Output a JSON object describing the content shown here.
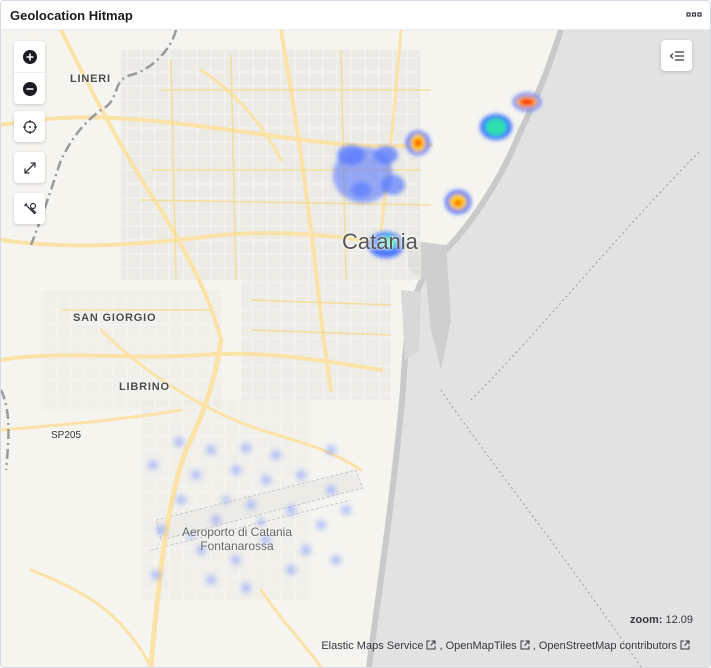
{
  "panel": {
    "title": "Geolocation Hitmap"
  },
  "map": {
    "labels": {
      "lineri": "LINERI",
      "san_giorgio": "SAN GIORGIO",
      "librino": "LIBRINO",
      "sp205": "SP205",
      "city": "Catania",
      "airport_line1": "Aeroporto di Catania",
      "airport_line2": "Fontanarossa"
    },
    "controls": [
      "zoom-in",
      "zoom-out",
      "fit-to-data",
      "fullscreen",
      "tools"
    ],
    "zoom_label": "zoom:",
    "zoom_value": "12.09",
    "attribution": [
      "Elastic Maps Service",
      "OpenMapTiles",
      "OpenStreetMap contributors"
    ],
    "colors": {
      "sea": "#e2e2e2",
      "land": "#f5f4ef",
      "road": "#fbe2a6",
      "heat_low": "#3d6bff",
      "heat_high": "#ff2a00"
    }
  }
}
